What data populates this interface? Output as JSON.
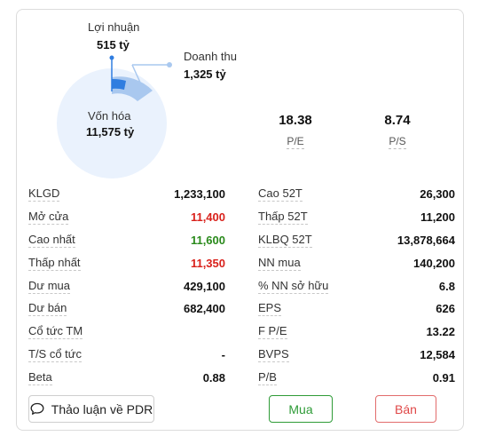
{
  "summary": {
    "profit_label": "Lợi nhuận",
    "profit_value": "515 tỷ",
    "revenue_label": "Doanh thu",
    "revenue_value": "1,325 tỷ",
    "market_cap_label": "Vốn hóa",
    "market_cap_value": "11,575 tỷ"
  },
  "ratios": [
    {
      "value": "18.38",
      "label": "P/E"
    },
    {
      "value": "8.74",
      "label": "P/S"
    }
  ],
  "left_stats": [
    {
      "label": "KLGD",
      "value": "1,233,100",
      "tone": "neutral"
    },
    {
      "label": "Mở cửa",
      "value": "11,400",
      "tone": "red"
    },
    {
      "label": "Cao nhất",
      "value": "11,600",
      "tone": "green"
    },
    {
      "label": "Thấp nhất",
      "value": "11,350",
      "tone": "red"
    },
    {
      "label": "Dư mua",
      "value": "429,100",
      "tone": "neutral"
    },
    {
      "label": "Dư bán",
      "value": "682,400",
      "tone": "neutral"
    },
    {
      "label": "Cổ tức TM",
      "value": "",
      "tone": "neutral"
    },
    {
      "label": "T/S cổ tức",
      "value": "-",
      "tone": "neutral"
    },
    {
      "label": "Beta",
      "value": "0.88",
      "tone": "neutral"
    }
  ],
  "right_stats": [
    {
      "label": "Cao 52T",
      "value": "26,300"
    },
    {
      "label": "Thấp 52T",
      "value": "11,200"
    },
    {
      "label": "KLBQ 52T",
      "value": "13,878,664"
    },
    {
      "label": "NN mua",
      "value": "140,200"
    },
    {
      "label": "% NN sở hữu",
      "value": "6.8"
    },
    {
      "label": "EPS",
      "value": "626"
    },
    {
      "label": "F P/E",
      "value": "13.22"
    },
    {
      "label": "BVPS",
      "value": "12,584"
    },
    {
      "label": "P/B",
      "value": "0.91"
    }
  ],
  "buttons": {
    "discuss": "Thảo luận về PDR",
    "buy": "Mua",
    "sell": "Bán"
  },
  "colors": {
    "circle_fill": "#eaf2fd",
    "revenue_arc": "#a9c8ef",
    "profit_arc": "#2f7de0",
    "up": "#2a8a1c",
    "down": "#d9221c"
  },
  "icons": {
    "discuss": "chat-bubble-icon"
  }
}
